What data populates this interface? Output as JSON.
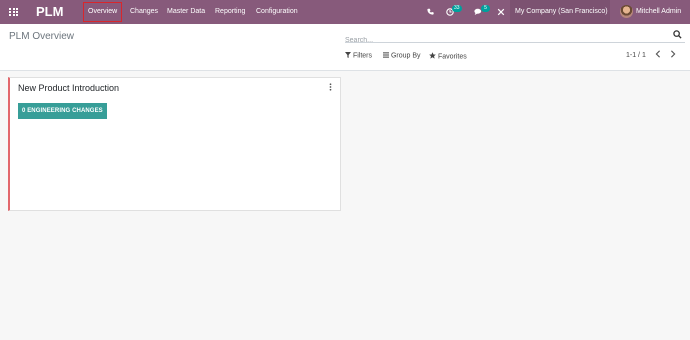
{
  "app": {
    "name": "PLM"
  },
  "menu": [
    {
      "label": "Overview",
      "active": true
    },
    {
      "label": "Changes",
      "active": false
    },
    {
      "label": "Master Data",
      "active": false
    },
    {
      "label": "Reporting",
      "active": false
    },
    {
      "label": "Configuration",
      "active": false
    }
  ],
  "systray": {
    "activity_count": "33",
    "message_count": "5",
    "company": "My Company (San Francisco)",
    "user": "Mitchell Admin"
  },
  "control_panel": {
    "title": "PLM Overview",
    "search_placeholder": "Search...",
    "filters_label": "Filters",
    "groupby_label": "Group By",
    "favorites_label": "Favorites",
    "pager": "1-1 / 1"
  },
  "kanban": {
    "cards": [
      {
        "title": "New Product Introduction",
        "button_label": "0 ENGINEERING CHANGES"
      }
    ]
  },
  "colors": {
    "navbar": "#875a7b",
    "accent_teal": "#379e98",
    "card_border": "#e2676c",
    "highlight_box": "#d9262c"
  }
}
